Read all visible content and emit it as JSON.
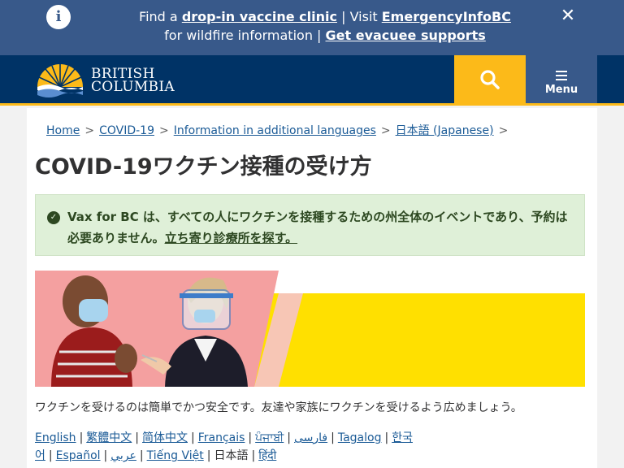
{
  "alert": {
    "text_find": "Find a ",
    "link_clinic": "drop-in vaccine clinic",
    "text_visit": " | Visit ",
    "link_emergency": "EmergencyInfoBC",
    "text_wildfire": "for wildfire information | ",
    "link_evacuee": "Get evacuee supports",
    "info_glyph": "i",
    "close_glyph": "✕"
  },
  "header": {
    "logo_line1": "BRITISH",
    "logo_line2": "COLUMBIA",
    "menu_label": "Menu"
  },
  "breadcrumb": [
    "Home",
    "COVID-19",
    "Information in additional languages",
    "日本語 (Japanese)"
  ],
  "breadcrumb_sep": ">",
  "page_title": "COVID-19ワクチン接種の受け方",
  "notice": {
    "check_glyph": "✓",
    "text": "Vax for BC は、すべての人にワクチンを接種するための州全体のイベントであり、予約は必要ありません。",
    "link": "立ち寄り診療所を探す。"
  },
  "intro_text": "ワクチンを受けるのは簡単でかつ安全です。友達や家族にワクチンを受けるよう広めましょう。",
  "languages": [
    "English",
    "繁體中文",
    "简体中文",
    "Français",
    "ਪੰਜਾਬੀ",
    "فارسی",
    "Tagalog",
    "한국어",
    "Español",
    "عربي",
    "Tiếng Việt",
    "日本語",
    "हिंदी"
  ],
  "current_language": "日本語",
  "colors": {
    "bc_blue": "#003366",
    "bc_gold": "#fcba19",
    "alert_blue": "#38598a",
    "link_blue": "#1a5a96",
    "success_bg": "#dff0d8",
    "banner_yellow": "#ffe000",
    "banner_pink": "#f4a0a0"
  }
}
